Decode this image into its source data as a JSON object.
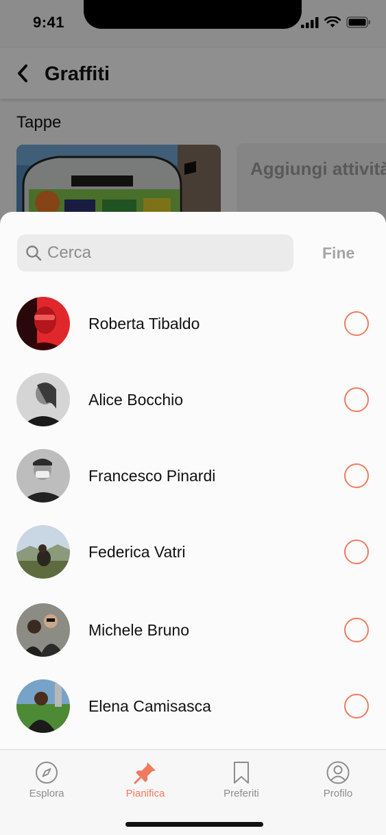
{
  "status": {
    "time": "9:41"
  },
  "header": {
    "title": "Graffiti"
  },
  "section": {
    "title": "Tappe"
  },
  "cards": {
    "add_label": "Aggiungi attività"
  },
  "search": {
    "placeholder": "Cerca",
    "done_label": "Fine"
  },
  "contacts": [
    {
      "name": "Roberta Tibaldo",
      "selected": false
    },
    {
      "name": "Alice Bocchio",
      "selected": false
    },
    {
      "name": "Francesco Pinardi",
      "selected": false
    },
    {
      "name": "Federica Vatri",
      "selected": false
    },
    {
      "name": "Michele Bruno",
      "selected": false
    },
    {
      "name": "Elena Camisasca",
      "selected": false
    }
  ],
  "tabs": [
    {
      "label": "Esplora",
      "icon": "compass-icon",
      "active": false
    },
    {
      "label": "Pianifica",
      "icon": "pin-icon",
      "active": true
    },
    {
      "label": "Preferiti",
      "icon": "bookmark-icon",
      "active": false
    },
    {
      "label": "Profilo",
      "icon": "profile-icon",
      "active": false
    }
  ],
  "colors": {
    "accent": "#f07a5d",
    "inactive": "#8c8c8c"
  }
}
